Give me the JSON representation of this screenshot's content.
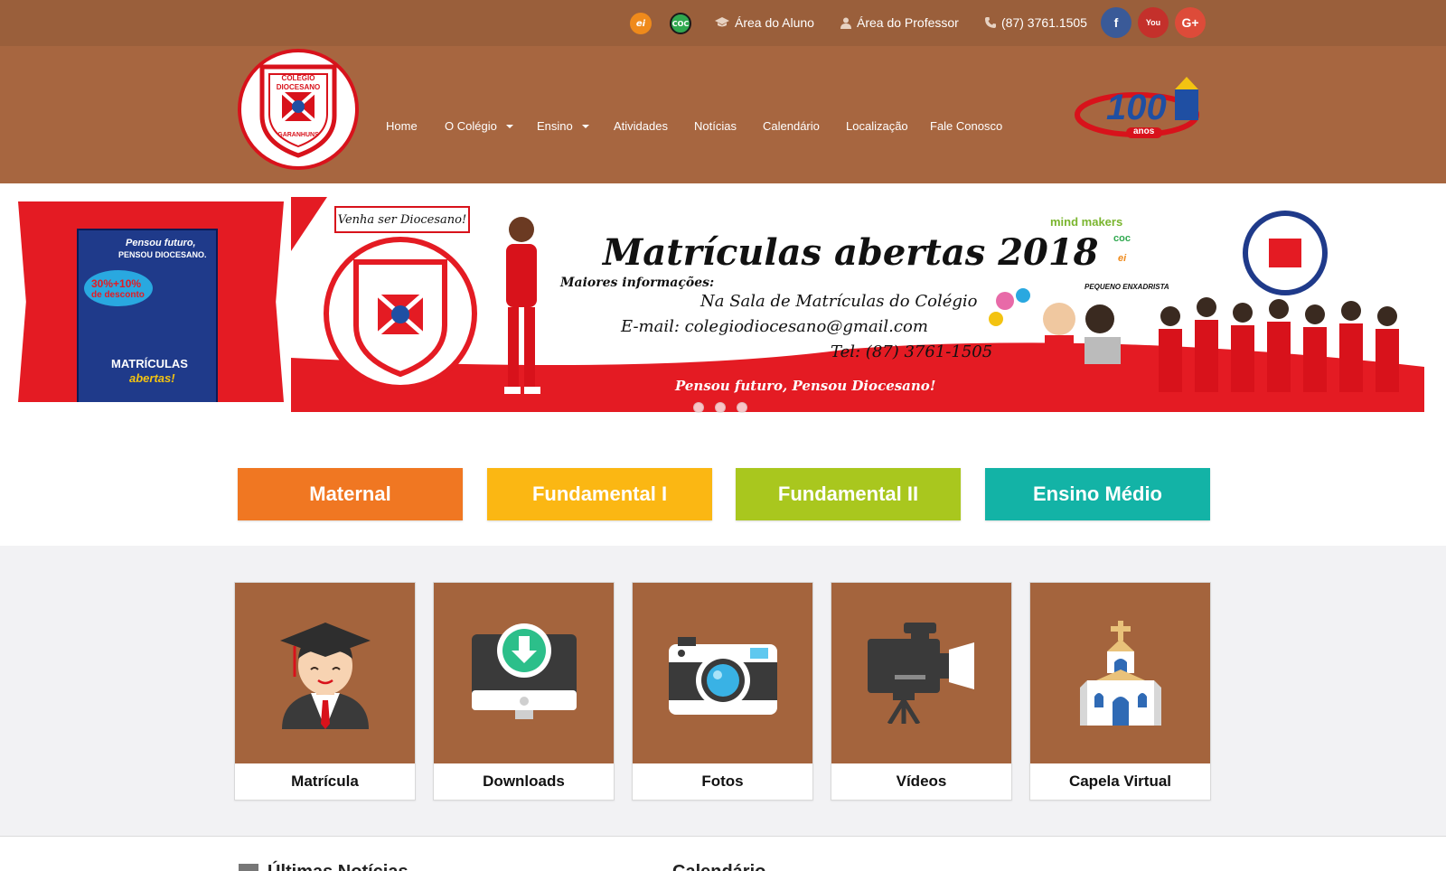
{
  "topbar": {
    "badge_ei": "ei",
    "badge_coc": "COC",
    "aluno": "Área do Aluno",
    "professor": "Área do Professor",
    "phone": "(87) 3761.1505",
    "social": {
      "facebook": "f",
      "youtube": "You",
      "google": "G+"
    }
  },
  "header": {
    "logo": {
      "line1": "COLÉGIO",
      "line2": "DIOCESANO",
      "line3": "GARANHUNS"
    },
    "nav": [
      "Home",
      "O Colégio",
      "Ensino",
      "Atividades",
      "Notícias",
      "Calendário",
      "Localização",
      "Fale Conosco"
    ],
    "centenary": {
      "number": "100",
      "word": "anos"
    }
  },
  "banner": {
    "flyer": {
      "line1": "Pensou futuro,",
      "line2": "PENSOU DIOCESANO.",
      "discount_a": "30%+10%",
      "discount_b": "de desconto",
      "title1": "MATRÍCULAS",
      "title2": "abertas!"
    },
    "speech": "Venha ser Diocesano!",
    "headline": "Matrículas abertas 2018",
    "info_title": "Maiores informações:",
    "info_line1": "Na Sala de Matrículas do Colégio",
    "info_line2": "E-mail: colegiodiocesano@gmail.com",
    "info_line3": "Tel: (87) 3761-1505",
    "footer": "Pensou futuro, Pensou Diocesano!",
    "brands": [
      "mind makers",
      "coc",
      "ei",
      "PEQUENO ENXADRISTA"
    ]
  },
  "levels": [
    {
      "label": "Maternal",
      "color": "#f07722"
    },
    {
      "label": "Fundamental I",
      "color": "#fbb713"
    },
    {
      "label": "Fundamental II",
      "color": "#a9c71e"
    },
    {
      "label": "Ensino Médio",
      "color": "#13b3a6"
    }
  ],
  "tiles": [
    {
      "label": "Matrícula",
      "icon": "graduate-icon"
    },
    {
      "label": "Downloads",
      "icon": "download-monitor-icon"
    },
    {
      "label": "Fotos",
      "icon": "camera-icon"
    },
    {
      "label": "Vídeos",
      "icon": "video-camera-icon"
    },
    {
      "label": "Capela Virtual",
      "icon": "chapel-icon"
    }
  ],
  "bottom": {
    "news": "Últimas Notícias",
    "calendar": "Calendário"
  },
  "colors": {
    "topbar": "#9a5f3b",
    "header": "#a76640",
    "tile": "#a4643d",
    "red": "#e41b23"
  }
}
